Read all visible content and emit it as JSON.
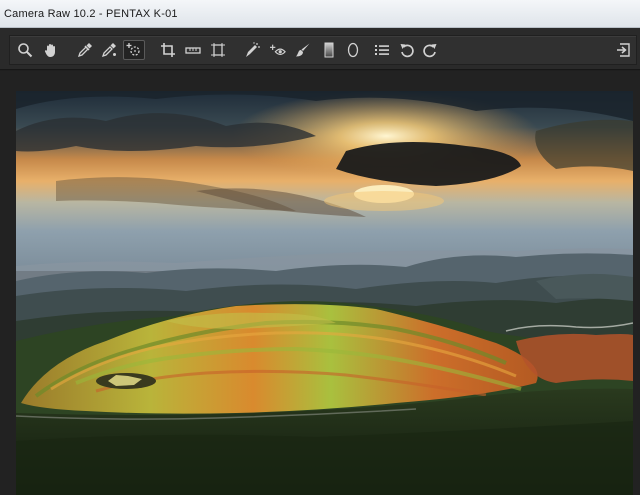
{
  "window": {
    "title": "Camera Raw 10.2 -  PENTAX K-01"
  },
  "toolbar": {
    "tools": [
      {
        "name": "zoom-tool",
        "icon": "magnifier-icon"
      },
      {
        "name": "hand-tool",
        "icon": "hand-icon"
      },
      {
        "name": "white-balance-tool",
        "icon": "eyedropper-icon"
      },
      {
        "name": "color-sampler-tool",
        "icon": "color-sampler-icon"
      },
      {
        "name": "targeted-adjustment-tool",
        "icon": "target-adjust-icon",
        "active": true
      },
      {
        "name": "crop-tool",
        "icon": "crop-icon"
      },
      {
        "name": "straighten-tool",
        "icon": "level-icon"
      },
      {
        "name": "transform-tool",
        "icon": "transform-icon"
      },
      {
        "name": "spot-removal-tool",
        "icon": "spot-brush-icon"
      },
      {
        "name": "red-eye-removal-tool",
        "icon": "red-eye-icon"
      },
      {
        "name": "adjustment-brush-tool",
        "icon": "brush-icon"
      },
      {
        "name": "graduated-filter-tool",
        "icon": "gradient-rect-icon"
      },
      {
        "name": "radial-filter-tool",
        "icon": "ellipse-icon"
      },
      {
        "name": "preferences-button",
        "icon": "list-icon"
      },
      {
        "name": "rotate-ccw-button",
        "icon": "rotate-ccw-icon"
      },
      {
        "name": "rotate-cw-button",
        "icon": "rotate-cw-icon"
      },
      {
        "name": "toggle-fullscreen-button",
        "icon": "fullscreen-exit-icon"
      }
    ]
  },
  "colors": {
    "title_bar": "#e6eaef",
    "workspace": "#222222",
    "toolbar": "#303030",
    "icon": "#d2d2d2"
  },
  "preview": {
    "subject": "terraced-hills-sunset-photo"
  }
}
